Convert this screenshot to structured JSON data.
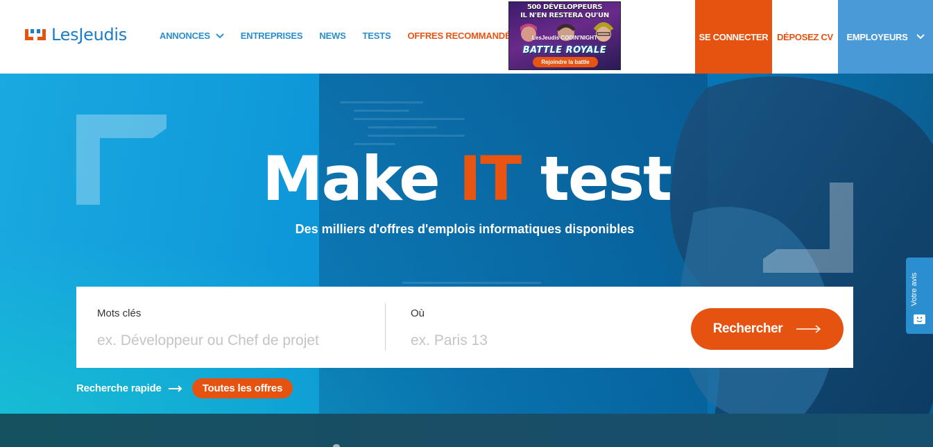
{
  "brand": {
    "name": "LesJeudis",
    "orange": "#e6520f",
    "blue": "#1b7cc7"
  },
  "nav": {
    "annonces": "ANNONCES",
    "entreprises": "ENTREPRISES",
    "news": "NEWS",
    "tests": "TESTS",
    "offres": "OFFRES RECOMMANDÉES"
  },
  "ad": {
    "line1": "500 DÉVELOPPEURS",
    "line2": "IL N'EN RESTERA QU'UN",
    "brand": "LesJeudis CODIN'NIGHT",
    "title": "BATTLE ROYALE",
    "cta": "Rejoindre la battle"
  },
  "header_actions": {
    "connect": "SE CONNECTER",
    "cv": "DÉPOSEZ CV",
    "employers": "EMPLOYEURS"
  },
  "hero": {
    "title_before": "Make ",
    "title_accent": "IT",
    "title_after": " test",
    "subtitle": "Des milliers d'offres d'emplois informatiques disponibles"
  },
  "search": {
    "keywords_label": "Mots clés",
    "keywords_placeholder": "ex. Développeur ou Chef de projet",
    "location_label": "Où",
    "location_placeholder": "ex. Paris 13",
    "button": "Rechercher"
  },
  "quick": {
    "label": "Recherche rapide",
    "all_offers": "Toutes les offres"
  },
  "feedback": {
    "label": "Votre avis"
  }
}
